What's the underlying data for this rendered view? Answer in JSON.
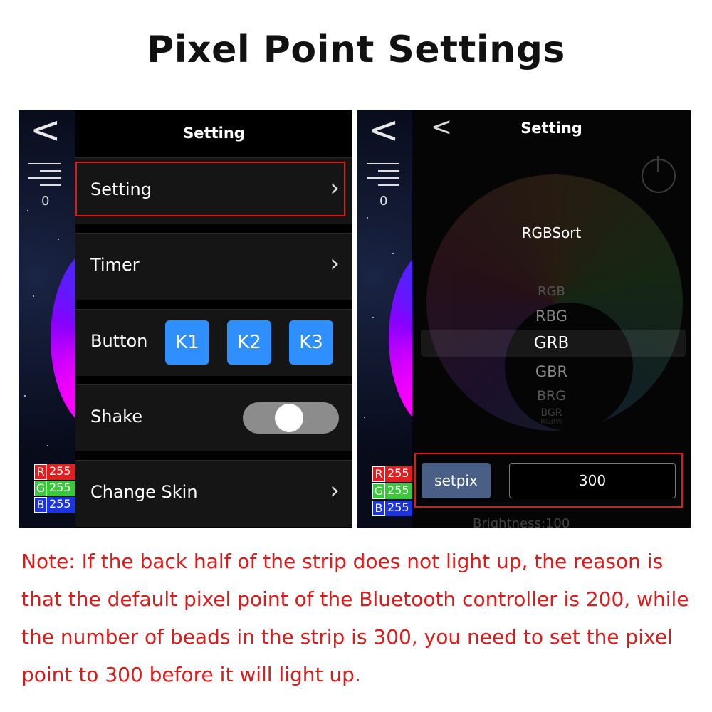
{
  "title": "Pixel Point Settings",
  "left_screen": {
    "back_glyph": "<",
    "counter": "0",
    "rgb": [
      {
        "channel": "R",
        "value": "255",
        "color": "#e02020"
      },
      {
        "channel": "G",
        "value": "255",
        "color": "#3cc83c"
      },
      {
        "channel": "B",
        "value": "255",
        "color": "#1c34e0"
      }
    ],
    "panel_title": "Setting",
    "rows": {
      "setting": "Setting",
      "timer": "Timer",
      "button": "Button",
      "shake": "Shake",
      "change_skin": "Change Skin"
    },
    "buttons": [
      "K1",
      "K2",
      "K3"
    ],
    "shake_toggle": "off"
  },
  "right_screen": {
    "back_glyph": "<",
    "counter": "0",
    "rgb": [
      {
        "channel": "R",
        "value": "255",
        "color": "#e02020"
      },
      {
        "channel": "G",
        "value": "255",
        "color": "#3cc83c"
      },
      {
        "channel": "B",
        "value": "255",
        "color": "#1c34e0"
      }
    ],
    "panel_title": "Setting",
    "picker_label": "RGBSort",
    "options": [
      "RGB",
      "RBG",
      "GRB",
      "GBR",
      "BRG",
      "BGR",
      "RGBW"
    ],
    "selected_option": "GRB",
    "setpix_label": "setpix",
    "pixel_value": "300",
    "brightness_label": "Brightness:100"
  },
  "note": "Note: If the back half of the strip does not light up, the reason is that the default pixel point of the Bluetooth controller is 200, while the number of beads in the strip is 300, you need to set the pixel point to 300 before it will light up.",
  "colors": {
    "accent_red": "#e01818",
    "button_blue": "#2f8fff",
    "setpix_blue": "#4a5f86"
  }
}
